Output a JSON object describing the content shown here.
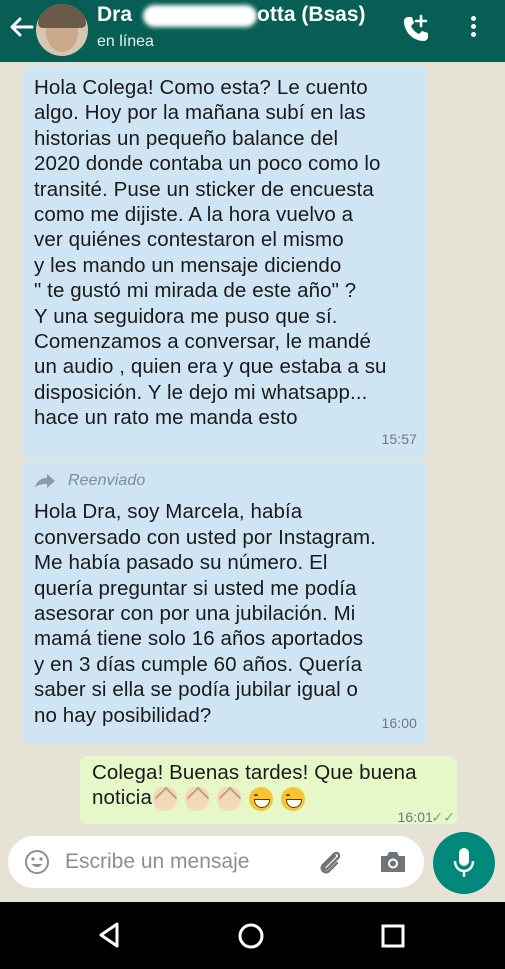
{
  "header": {
    "contact_name_start": "Dra",
    "contact_name_end": "otta (Bsas)",
    "status": "en línea",
    "colors": {
      "bar": "#075e54"
    },
    "icons": [
      "back-arrow-icon",
      "avatar",
      "add-call-icon",
      "more-options-icon"
    ]
  },
  "messages": [
    {
      "direction": "incoming",
      "lines": [
        "Hola Colega! Como esta? Le cuento",
        "algo. Hoy por la mañana subí en las",
        "historias un pequeño balance del",
        "2020 donde contaba un poco como lo",
        "transité. Puse un sticker de encuesta",
        "como me dijiste. A la hora vuelvo a",
        "ver quiénes contestaron el mismo",
        "y les mando un mensaje diciendo",
        "\" te gustó mi mirada de este año\" ?",
        "Y una seguidora me puso que sí.",
        "Comenzamos a conversar,  le mandé",
        "un audio , quien era y que estaba a su",
        "disposición.  Y le dejo mi whatsapp...",
        "hace un rato me manda esto"
      ],
      "time": "15:57"
    },
    {
      "direction": "incoming",
      "forwarded_label": "Reenviado",
      "lines": [
        "Hola Dra, soy Marcela, había",
        "conversado con usted por Instagram.",
        "Me había pasado su número.  El",
        "quería preguntar si usted me podía",
        "asesorar con por una jubilación. Mi",
        "mamá tiene solo 16 años aportados",
        "y en 3 días cumple 60 años. Quería",
        "saber si ella se podía jubilar igual o",
        "no hay posibilidad?"
      ],
      "time": "16:00"
    },
    {
      "direction": "outgoing",
      "lines": [
        "Colega! Buenas tardes! Que buena",
        "noticia"
      ],
      "emojis": [
        "clapping-hands",
        "clapping-hands",
        "clapping-hands",
        "grinning-face",
        "grinning-face"
      ],
      "time": "16:01",
      "status": "read"
    }
  ],
  "input": {
    "placeholder": "Escribe un mensaje",
    "icons": [
      "emoji-icon",
      "attach-icon",
      "camera-icon",
      "mic-icon"
    ],
    "colors": {
      "mic_button": "#00897b"
    }
  },
  "system_nav": {
    "icons": [
      "nav-back-icon",
      "nav-home-icon",
      "nav-recents-icon"
    ]
  }
}
